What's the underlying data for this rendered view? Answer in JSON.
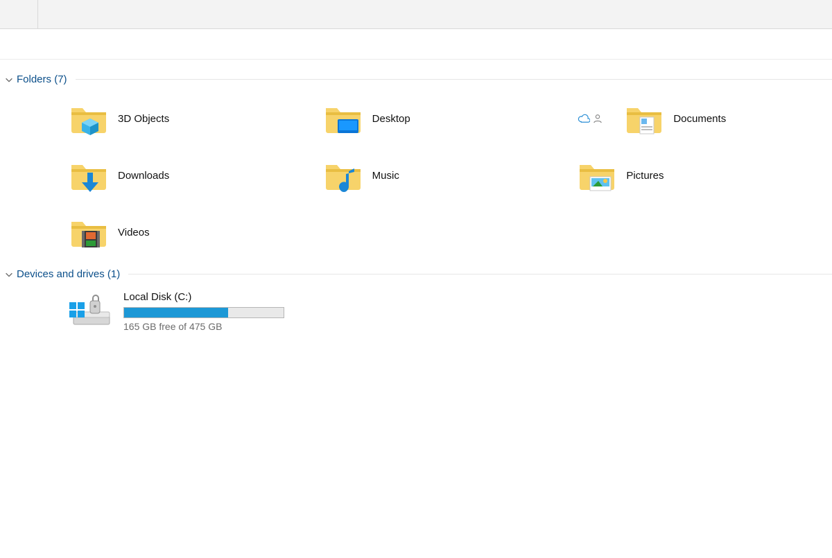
{
  "sections": {
    "folders": {
      "title": "Folders",
      "count": 7
    },
    "drives": {
      "title": "Devices and drives",
      "count": 1
    }
  },
  "folders": [
    {
      "label": "3D Objects"
    },
    {
      "label": "Desktop"
    },
    {
      "label": "Documents"
    },
    {
      "label": "Downloads"
    },
    {
      "label": "Music"
    },
    {
      "label": "Pictures"
    },
    {
      "label": "Videos"
    }
  ],
  "drives": [
    {
      "label": "Local Disk (C:)",
      "free": "165 GB free of 475 GB",
      "used_pct": 65
    }
  ],
  "colors": {
    "section_header": "#0b4f8a",
    "capacity_fill": "#1d98d6"
  }
}
